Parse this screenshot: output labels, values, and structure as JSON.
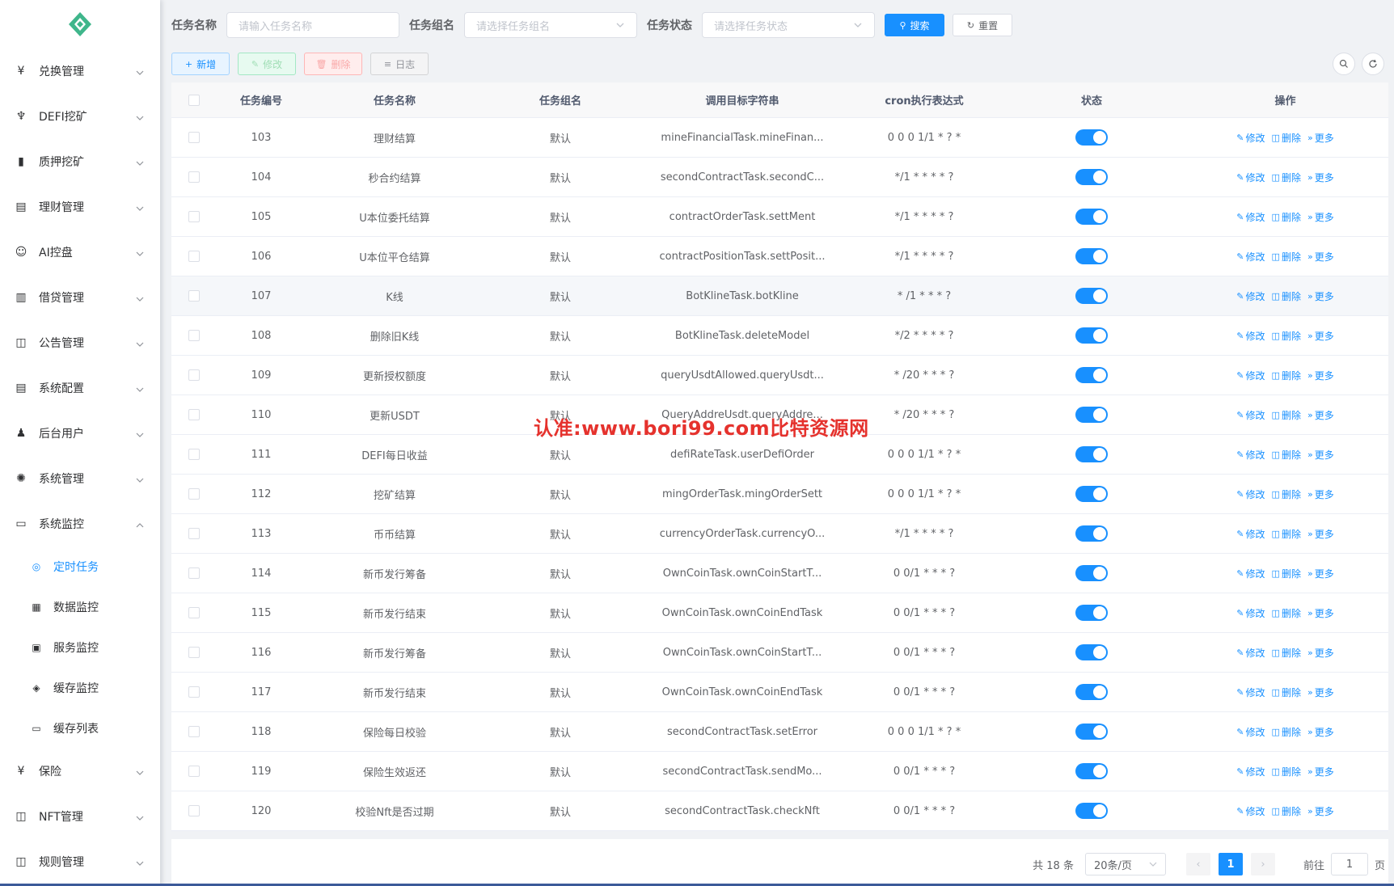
{
  "sidebar": {
    "items": [
      {
        "label": "兑换管理",
        "icon": "yen-icon"
      },
      {
        "label": "DEFI挖矿",
        "icon": "steps-icon"
      },
      {
        "label": "质押挖矿",
        "icon": "bar-chart-icon"
      },
      {
        "label": "理财管理",
        "icon": "document-icon"
      },
      {
        "label": "AI控盘",
        "icon": "robot-icon"
      },
      {
        "label": "借贷管理",
        "icon": "book-icon"
      },
      {
        "label": "公告管理",
        "icon": "open-book-icon"
      },
      {
        "label": "系统配置",
        "icon": "document-icon"
      },
      {
        "label": "后台用户",
        "icon": "users-icon"
      },
      {
        "label": "系统管理",
        "icon": "gear-icon"
      },
      {
        "label": "系统监控",
        "icon": "monitor-icon"
      }
    ],
    "submenu": [
      {
        "label": "定时任务",
        "icon": "timer-icon",
        "active": true
      },
      {
        "label": "数据监控",
        "icon": "chart-icon"
      },
      {
        "label": "服务监控",
        "icon": "server-icon"
      },
      {
        "label": "缓存监控",
        "icon": "stack-icon"
      },
      {
        "label": "缓存列表",
        "icon": "monitor-list-icon"
      }
    ],
    "items_after": [
      {
        "label": "保险",
        "icon": "yen-icon"
      },
      {
        "label": "NFT管理",
        "icon": "grid-icon"
      },
      {
        "label": "规则管理",
        "icon": "open-book-icon"
      }
    ]
  },
  "search": {
    "job_name_label": "任务名称",
    "job_name_placeholder": "请输入任务名称",
    "job_group_label": "任务组名",
    "job_group_placeholder": "请选择任务组名",
    "job_status_label": "任务状态",
    "job_status_placeholder": "请选择任务状态",
    "search_btn": "搜索",
    "reset_btn": "重置"
  },
  "toolbar": {
    "add": "新增",
    "edit": "修改",
    "delete": "删除",
    "log": "日志"
  },
  "table": {
    "headers": {
      "id": "任务编号",
      "name": "任务名称",
      "group": "任务组名",
      "target": "调用目标字符串",
      "cron": "cron执行表达式",
      "status": "状态",
      "ops": "操作"
    },
    "ops": {
      "edit": "修改",
      "delete": "删除",
      "more": "更多"
    },
    "rows": [
      {
        "id": "103",
        "name": "理财结算",
        "group": "默认",
        "target": "mineFinancialTask.mineFinan...",
        "cron": "0 0 0 1/1 * ? *",
        "enabled": true
      },
      {
        "id": "104",
        "name": "秒合约结算",
        "group": "默认",
        "target": "secondContractTask.secondC...",
        "cron": "*/1 * * * * ?",
        "enabled": true
      },
      {
        "id": "105",
        "name": "U本位委托结算",
        "group": "默认",
        "target": "contractOrderTask.settMent",
        "cron": "*/1 * * * * ?",
        "enabled": true
      },
      {
        "id": "106",
        "name": "U本位平仓结算",
        "group": "默认",
        "target": "contractPositionTask.settPosit...",
        "cron": "*/1 * * * * ?",
        "enabled": true
      },
      {
        "id": "107",
        "name": "K线",
        "group": "默认",
        "target": "BotKlineTask.botKline",
        "cron": "* /1 * * * ?",
        "enabled": true
      },
      {
        "id": "108",
        "name": "删除旧K线",
        "group": "默认",
        "target": "BotKlineTask.deleteModel",
        "cron": "*/2 * * * * ?",
        "enabled": true
      },
      {
        "id": "109",
        "name": "更新授权额度",
        "group": "默认",
        "target": "queryUsdtAllowed.queryUsdt...",
        "cron": "* /20 * * * ?",
        "enabled": true
      },
      {
        "id": "110",
        "name": "更新USDT",
        "group": "默认",
        "target": "QueryAddreUsdt.queryAddre...",
        "cron": "* /20 * * * ?",
        "enabled": true
      },
      {
        "id": "111",
        "name": "DEFI每日收益",
        "group": "默认",
        "target": "defiRateTask.userDefiOrder",
        "cron": "0 0 0 1/1 * ? *",
        "enabled": true
      },
      {
        "id": "112",
        "name": "挖矿结算",
        "group": "默认",
        "target": "mingOrderTask.mingOrderSett",
        "cron": "0 0 0 1/1 * ? *",
        "enabled": true
      },
      {
        "id": "113",
        "name": "币币结算",
        "group": "默认",
        "target": "currencyOrderTask.currencyO...",
        "cron": "*/1 * * * * ?",
        "enabled": true
      },
      {
        "id": "114",
        "name": "新币发行筹备",
        "group": "默认",
        "target": "OwnCoinTask.ownCoinStartT...",
        "cron": "0 0/1 * * * ?",
        "enabled": true
      },
      {
        "id": "115",
        "name": "新币发行结束",
        "group": "默认",
        "target": "OwnCoinTask.ownCoinEndTask",
        "cron": "0 0/1 * * * ?",
        "enabled": true
      },
      {
        "id": "116",
        "name": "新币发行筹备",
        "group": "默认",
        "target": "OwnCoinTask.ownCoinStartT...",
        "cron": "0 0/1 * * * ?",
        "enabled": true
      },
      {
        "id": "117",
        "name": "新币发行结束",
        "group": "默认",
        "target": "OwnCoinTask.ownCoinEndTask",
        "cron": "0 0/1 * * * ?",
        "enabled": true
      },
      {
        "id": "118",
        "name": "保险每日校验",
        "group": "默认",
        "target": "secondContractTask.setError",
        "cron": "0 0 0 1/1 * ? *",
        "enabled": true
      },
      {
        "id": "119",
        "name": "保险生效返还",
        "group": "默认",
        "target": "secondContractTask.sendMo...",
        "cron": "0 0/1 * * * ?",
        "enabled": true
      },
      {
        "id": "120",
        "name": "校验Nft是否过期",
        "group": "默认",
        "target": "secondContractTask.checkNft",
        "cron": "0 0/1 * * * ?",
        "enabled": true
      }
    ]
  },
  "pagination": {
    "total_text": "共 18 条",
    "page_size": "20条/页",
    "current_page": "1",
    "goto_label": "前往",
    "goto_value": "1",
    "page_suffix": "页"
  },
  "watermark": "认准:www.bori99.com比特资源网",
  "colors": {
    "primary": "#1890ff",
    "logo": "#3fb68b"
  }
}
